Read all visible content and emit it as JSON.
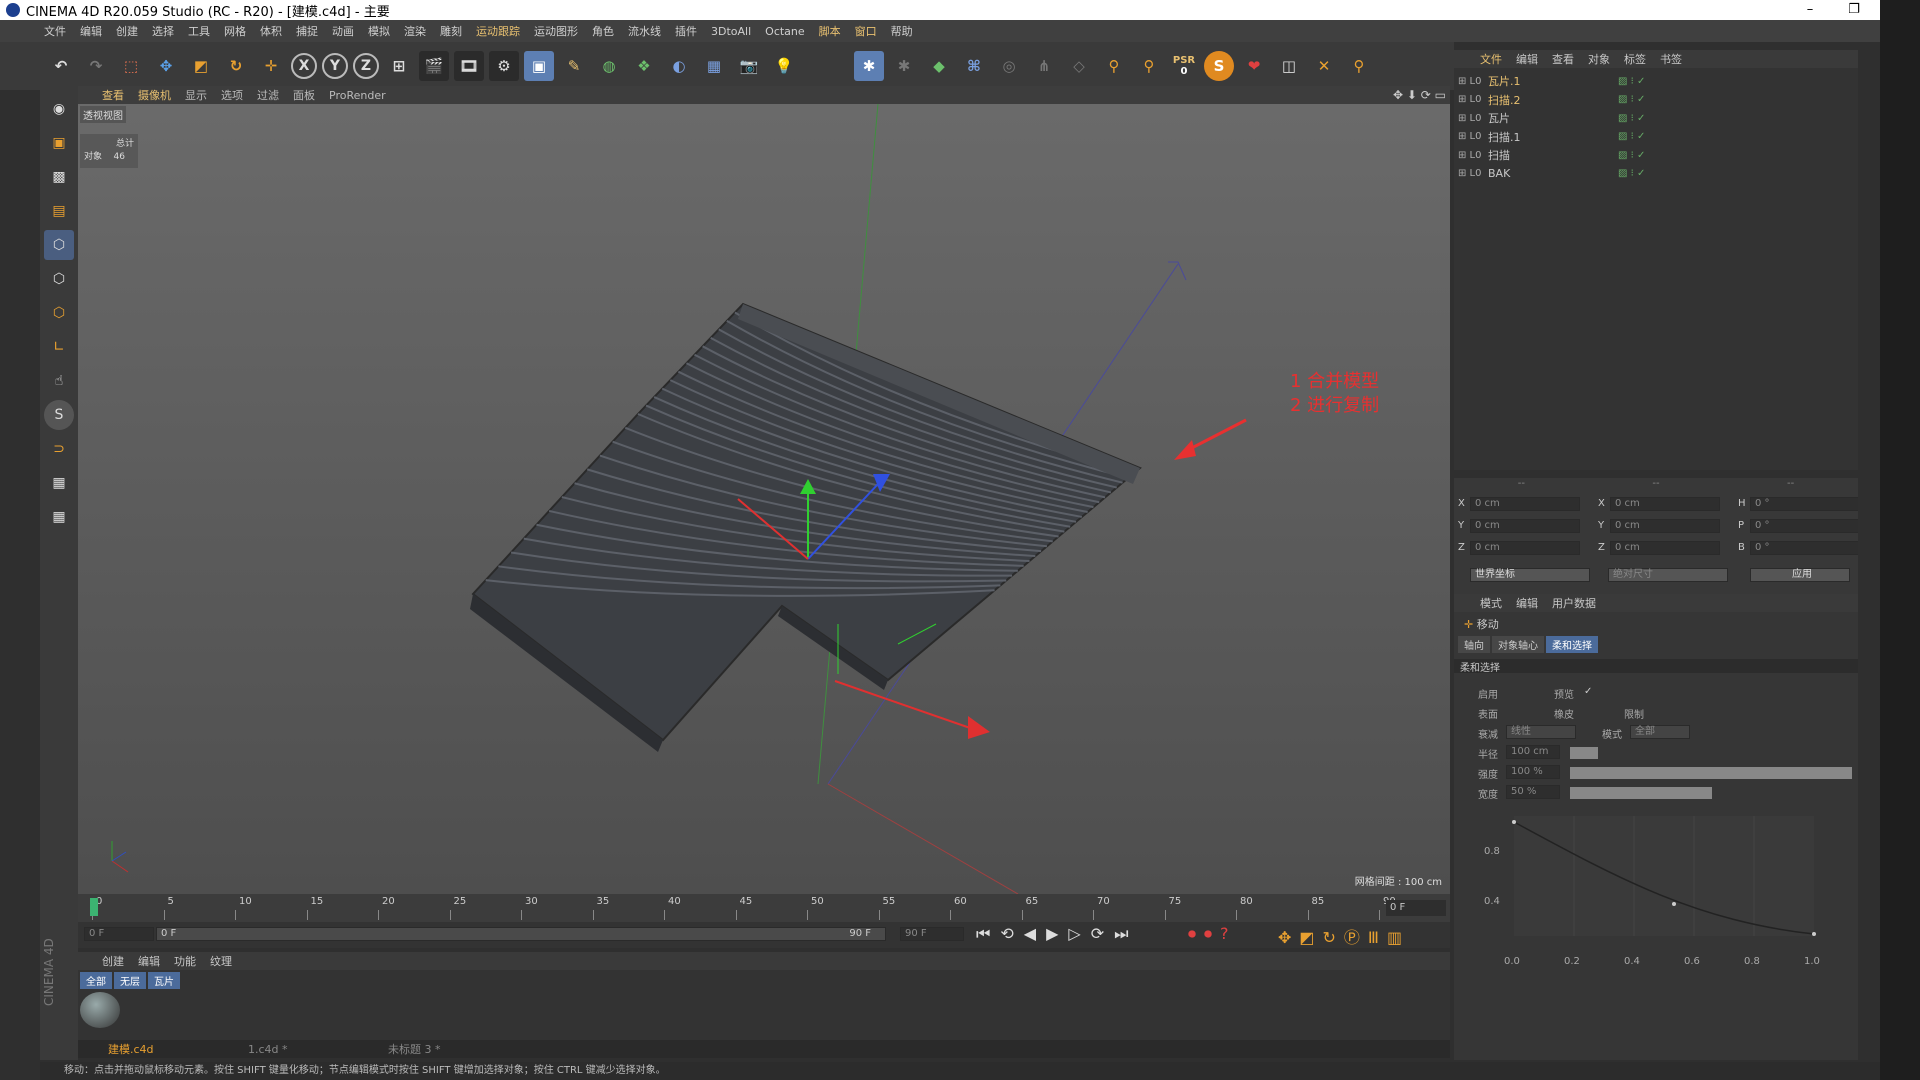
{
  "window": {
    "title": "CINEMA 4D R20.059 Studio (RC - R20) - [建模.c4d] - 主要",
    "minimize": "–",
    "restore": "❐",
    "close": "✕"
  },
  "menu": [
    "文件",
    "编辑",
    "创建",
    "选择",
    "工具",
    "网格",
    "体积",
    "捕捉",
    "动画",
    "模拟",
    "渲染",
    "雕刻",
    "运动跟踪",
    "运动图形",
    "角色",
    "流水线",
    "插件",
    "3DtoAll",
    "Octane",
    "脚本",
    "窗口",
    "帮助"
  ],
  "toolbar": {
    "x": "X",
    "y": "Y",
    "z": "Z",
    "psr": "PSR",
    "psr_val": "0"
  },
  "viewport": {
    "menu": [
      "查看",
      "摄像机",
      "显示",
      "选项",
      "过滤",
      "面板",
      "ProRender"
    ],
    "view_name": "透视视图",
    "stats_title": "总计",
    "stats_label": "对象",
    "stats_value": "46",
    "grid_info": "网格间距 : 100 cm",
    "annotation_line1": "1 合并模型",
    "annotation_line2": "2 进行复制"
  },
  "timeline": {
    "ticks": [
      "0",
      "5",
      "10",
      "15",
      "20",
      "25",
      "30",
      "35",
      "40",
      "45",
      "50",
      "55",
      "60",
      "65",
      "70",
      "75",
      "80",
      "85",
      "90"
    ],
    "end_frame": "0 F",
    "start_field": "0 F",
    "range_start": "0 F",
    "range_end": "90 F",
    "max_field": "90 F"
  },
  "materials": {
    "menu": [
      "创建",
      "编辑",
      "功能",
      "纹理"
    ],
    "filters": [
      "全部",
      "无层",
      "瓦片"
    ]
  },
  "files": {
    "tabs": [
      "建模.c4d",
      "1.c4d *",
      "未标题 3 *"
    ]
  },
  "objects": {
    "menu": [
      "文件",
      "编辑",
      "查看",
      "对象",
      "标签",
      "书签"
    ],
    "rows": [
      {
        "name": "瓦片.1",
        "color": "#e8c070"
      },
      {
        "name": "扫描.2",
        "color": "#e8c070"
      },
      {
        "name": "瓦片",
        "color": "#c8c8c8"
      },
      {
        "name": "扫描.1",
        "color": "#c8c8c8"
      },
      {
        "name": "扫描",
        "color": "#c8c8c8"
      },
      {
        "name": "BAK",
        "color": "#c8c8c8"
      }
    ]
  },
  "coords": {
    "header": [
      "--",
      "--",
      "--"
    ],
    "rows": [
      {
        "a": "X",
        "av": "0 cm",
        "b": "X",
        "bv": "0 cm",
        "c": "H",
        "cv": "0 °"
      },
      {
        "a": "Y",
        "av": "0 cm",
        "b": "Y",
        "bv": "0 cm",
        "c": "P",
        "cv": "0 °"
      },
      {
        "a": "Z",
        "av": "0 cm",
        "b": "Z",
        "bv": "0 cm",
        "c": "B",
        "cv": "0 °"
      }
    ],
    "world": "世界坐标",
    "size": "绝对尺寸",
    "apply": "应用"
  },
  "attributes": {
    "menu": [
      "模式",
      "编辑",
      "用户数据"
    ],
    "title": "移动",
    "tabs": [
      "轴向",
      "对象轴心",
      "柔和选择"
    ],
    "section": "柔和选择",
    "enable": "启用",
    "preview": "预览",
    "surface": "表面",
    "rubber": "橡皮",
    "restrict": "限制",
    "falloff": "衰减",
    "falloff_val": "线性",
    "mode": "模式",
    "mode_val": "全部",
    "radius": "半径",
    "radius_val": "100 cm",
    "strength": "强度",
    "strength_val": "100 %",
    "width": "宽度",
    "width_val": "50 %",
    "graph_y": [
      "0.8",
      "0.4"
    ],
    "graph_x": [
      "0.0",
      "0.2",
      "0.4",
      "0.6",
      "0.8",
      "1.0"
    ]
  },
  "status": "移动：点击并拖动鼠标移动元素。按住 SHIFT 键量化移动；节点编辑模式时按住 SHIFT 键增加选择对象；按住 CTRL 键减少选择对象。",
  "brand": "CINEMA 4D",
  "colors": {
    "accent": "#e8c070",
    "annotation": "#e83030",
    "selected_tab": "#4b6b9b"
  }
}
